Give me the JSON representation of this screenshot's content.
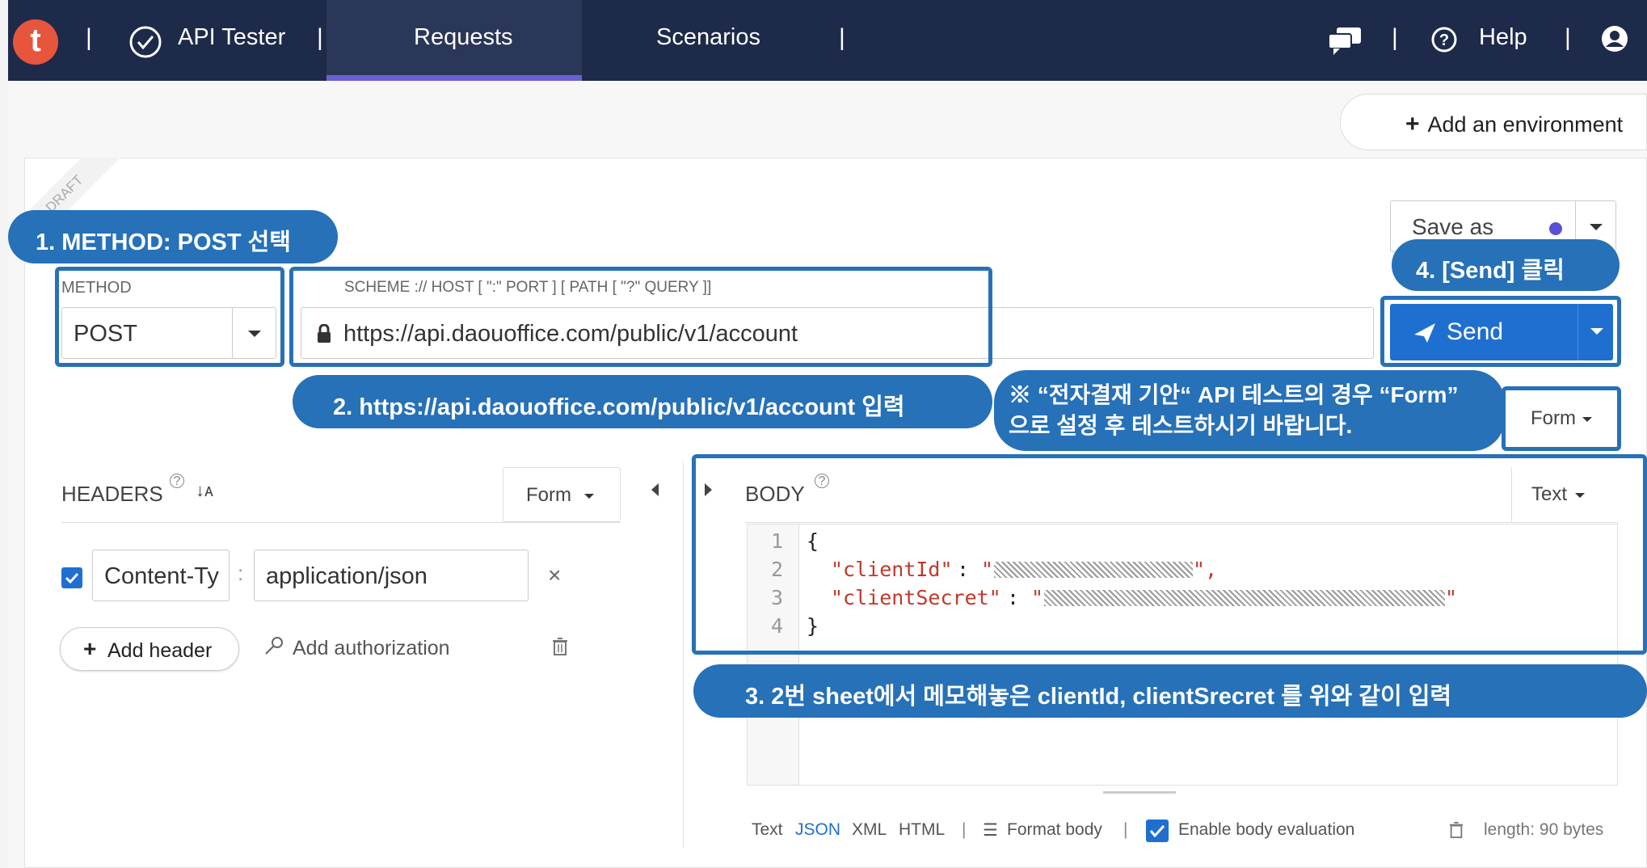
{
  "nav": {
    "logo": "t",
    "app_name": "API Tester",
    "tabs": [
      "Requests",
      "Scenarios"
    ],
    "help": "Help",
    "separator": "|"
  },
  "toolbar": {
    "add_environment": "Add an environment",
    "draft_ribbon": "DRAFT",
    "save_as": "Save as"
  },
  "request": {
    "method_label": "METHOD",
    "method_value": "POST",
    "url_hint": "SCHEME :// HOST [ \":\" PORT ] [ PATH [ \"?\" QUERY ]]",
    "url_value": "https://api.daouoffice.com/public/v1/account",
    "send": "Send"
  },
  "headers": {
    "title": "HEADERS",
    "mode": "Form",
    "key": "Content-Ty",
    "value": "application/json",
    "add_header": "Add header",
    "add_authorization": "Add authorization"
  },
  "body": {
    "title": "BODY",
    "mode_top": "Form",
    "mode": "Text",
    "lines": [
      {
        "num": "1",
        "text": "{"
      },
      {
        "num": "2",
        "key": "\"clientId\"",
        "sep": ": ",
        "open": "\"",
        "close": "\","
      },
      {
        "num": "3",
        "key": "\"clientSecret\"",
        "sep": ": ",
        "open": "\"",
        "close": "\""
      },
      {
        "num": "4",
        "text": "}"
      }
    ],
    "formats": [
      "Text",
      "JSON",
      "XML",
      "HTML"
    ],
    "format_body": "Format body",
    "enable_eval": "Enable body evaluation",
    "length": "length: 90 bytes"
  },
  "annotations": {
    "step1": "1. METHOD: POST 선택",
    "step2": "2. https://api.daouoffice.com/public/v1/account 입력",
    "step3": "3. 2번 sheet에서 메모해놓은 clientId, clientSrecret 를 위와 같이 입력",
    "step4": "4. [Send] 클릭",
    "note_line1": "※ “전자결재 기안“ API 테스트의 경우 “Form”",
    "note_line2": "으로 설정 후 테스트하시기 바랍니다."
  },
  "colors": {
    "nav_bg": "#1e2a4a",
    "accent": "#2671b8",
    "send_bg": "#1f6fd0",
    "tab_underline": "#6b5fd6"
  }
}
